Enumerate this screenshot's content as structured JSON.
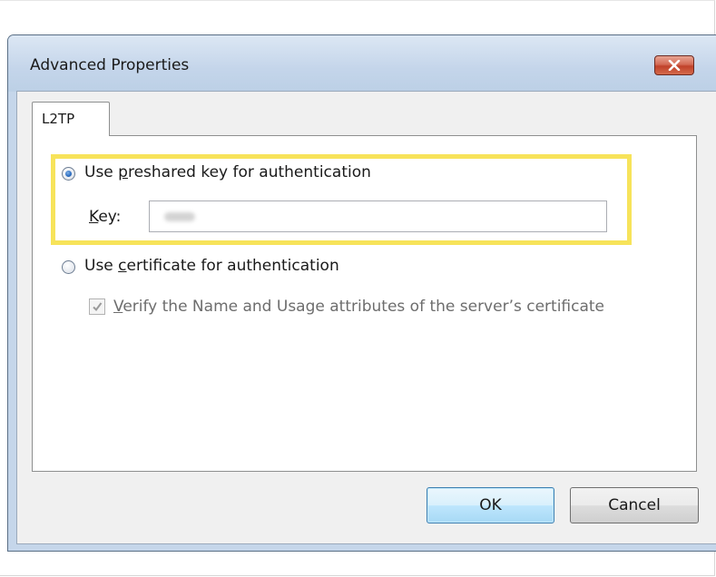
{
  "window": {
    "title": "Advanced Properties",
    "close_icon": "close-icon"
  },
  "tabs": [
    {
      "label": "L2TP",
      "selected": true
    }
  ],
  "options": {
    "preshared": {
      "label_prefix": "Use ",
      "label_accel": "p",
      "label_rest": "reshared key for authentication",
      "selected": true
    },
    "key": {
      "label_accel": "K",
      "label_rest": "ey:",
      "value": "",
      "masked": true
    },
    "certificate": {
      "label_prefix": "Use ",
      "label_accel": "c",
      "label_rest": "ertificate for authentication",
      "selected": false
    },
    "verify": {
      "label_accel": "V",
      "label_rest": "erify the Name and Usage attributes of the server’s certificate",
      "checked": true,
      "enabled": false
    }
  },
  "buttons": {
    "ok": "OK",
    "cancel": "Cancel"
  },
  "colors": {
    "highlight": "#f7e35a",
    "disabled_text": "#6d6d6d",
    "default_button_border": "#3c7fb1"
  }
}
